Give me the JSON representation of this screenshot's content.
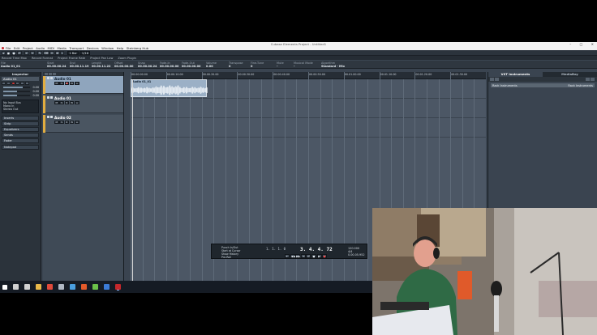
{
  "window": {
    "title": "Cubase Elements Project - Untitled1",
    "controls": [
      "–",
      "□",
      "✕"
    ]
  },
  "menu": [
    "File",
    "Edit",
    "Project",
    "Audio",
    "MIDI",
    "Media",
    "Transport",
    "Devices",
    "Window",
    "Help",
    "Steinberg Hub"
  ],
  "toolbar": {
    "buttons": [
      "▸",
      "◼",
      "●",
      "↺",
      "⇤",
      "⇥",
      "✎",
      "⌫",
      "✂",
      "⊕",
      "⌕"
    ],
    "snap_value": "1 Bar",
    "quantize_value": "1/16"
  },
  "status": [
    "Record Time Max",
    "Record Format",
    "Project Frame Rate",
    "Project Pan Law",
    "Zoom Plugin"
  ],
  "info_line": [
    {
      "label": "File",
      "value": "Audio 01_01"
    },
    {
      "label": "Start",
      "value": "00.00.00.24"
    },
    {
      "label": "End",
      "value": "00.00.11.19"
    },
    {
      "label": "Length",
      "value": "00.00.11.22"
    },
    {
      "label": "Offset",
      "value": "00.00.00.00"
    },
    {
      "label": "Snap",
      "value": "00.00.00.24"
    },
    {
      "label": "Fade-In",
      "value": "00.00.00.00"
    },
    {
      "label": "Fade-Out",
      "value": "00.00.00.00"
    },
    {
      "label": "Volume",
      "value": "0.00"
    },
    {
      "label": "Transpose",
      "value": "0"
    },
    {
      "label": "Fine-Tune",
      "value": "0"
    },
    {
      "label": "Mute",
      "value": "-"
    },
    {
      "label": "Musical Mode",
      "value": "-"
    },
    {
      "label": "Algorithm",
      "value": "Standard - Mix"
    }
  ],
  "inspector": {
    "title": "Inspector",
    "track_name": "Audio 01",
    "rows": [
      {
        "value": "0.00",
        "fraction": 0.72
      },
      {
        "value": "0.00",
        "fraction": 0.5
      },
      {
        "value": "0.00",
        "fraction": 0.5
      }
    ],
    "routing": [
      "No Input Bus",
      "Mono In",
      "Stereo Out"
    ],
    "sections": [
      "Inserts",
      "Strip",
      "Equalizers",
      "Sends",
      "Fader",
      "Notepad"
    ]
  },
  "tracks": [
    {
      "name": "Audio 01",
      "selected": true
    },
    {
      "name": "Audio 01",
      "selected": false
    },
    {
      "name": "Audio 02",
      "selected": false
    }
  ],
  "track_buttons": [
    "M",
    "S",
    "R",
    "W",
    "e"
  ],
  "ruler": [
    {
      "label": "00.00.00.00",
      "pos": 0.0
    },
    {
      "label": "00.00.10.00",
      "pos": 0.1
    },
    {
      "label": "00.00.20.00",
      "pos": 0.2
    },
    {
      "label": "00.00.30.00",
      "pos": 0.3
    },
    {
      "label": "00.00.40.00",
      "pos": 0.4
    },
    {
      "label": "00.00.50.00",
      "pos": 0.5
    },
    {
      "label": "00.01.00.00",
      "pos": 0.6
    },
    {
      "label": "00.01.10.00",
      "pos": 0.7
    },
    {
      "label": "00.01.20.00",
      "pos": 0.8
    },
    {
      "label": "00.01.30.00",
      "pos": 0.9
    }
  ],
  "audio_event": {
    "title": "Audio 01_01"
  },
  "right_panel": {
    "tabs": [
      "VST Instruments",
      "MediaBay"
    ],
    "active_tab": 0,
    "rack_label": "Rack Instruments",
    "rack_right": "Rack Instruments"
  },
  "transport": {
    "markers": [
      "Punch In/Out",
      "Start at Cursor",
      "Show History",
      "Pre-Roll"
    ],
    "position_main": "3. 4. 4. 72",
    "position_secondary": "1. 1. 1. 0",
    "time_readout": "0.00.05.952",
    "buttons": [
      "⇤",
      "◀◀",
      "▶▶",
      "⇥",
      "↺",
      "◼",
      "▶",
      "●"
    ],
    "tempo": [
      "120.000",
      "4/4"
    ]
  },
  "taskbar_icons": [
    {
      "name": "windows-start-icon",
      "color": "#ffffff"
    },
    {
      "name": "search-icon",
      "color": "#d0d0d0"
    },
    {
      "name": "task-view-icon",
      "color": "#d0d0d0"
    },
    {
      "name": "file-explorer-icon",
      "color": "#e8b84a"
    },
    {
      "name": "chrome-icon",
      "color": "#e04a3b"
    },
    {
      "name": "settings-icon",
      "color": "#b0b8c4"
    },
    {
      "name": "store-icon",
      "color": "#4a9fe0"
    },
    {
      "name": "media-icon",
      "color": "#e35a2a"
    },
    {
      "name": "photos-icon",
      "color": "#6cc24a"
    },
    {
      "name": "app-icon",
      "color": "#3b7bd6"
    },
    {
      "name": "cubase-taskbar-icon",
      "color": "#c4272b"
    }
  ]
}
